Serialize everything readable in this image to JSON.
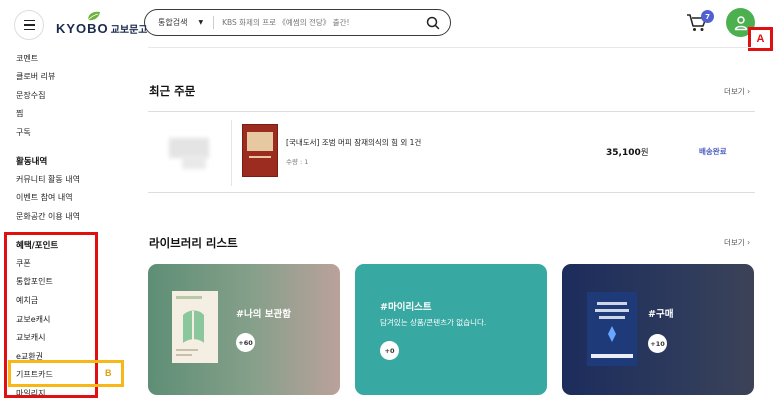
{
  "header": {
    "logo_en": "KYOBO",
    "logo_ko": "교보문고",
    "search_category": "통합검색",
    "search_placeholder": "KBS 화제의 프로 《예썸의 전당》 출간!",
    "cart_count": "7",
    "annotation_a": "A"
  },
  "sidebar": {
    "items_top": [
      "코멘트",
      "클로버 리뷰",
      "문장수집",
      "찜",
      "구독"
    ],
    "activity_title": "활동내역",
    "activity_items": [
      "커뮤니티 활동 내역",
      "이벤트 참여 내역",
      "문화공간 이용 내역"
    ],
    "benefit_title": "혜택/포인트",
    "benefit_items": [
      "쿠폰",
      "통합포인트",
      "예치금",
      "교보e캐시",
      "교보캐시",
      "e교환권",
      "기프트카드",
      "마일리지"
    ],
    "annotation_b": "B"
  },
  "recent_orders": {
    "title": "최근 주문",
    "more": "더보기 ›",
    "order": {
      "title": "[국내도서] 조범 머피 잠재의식의 힘 외 1건",
      "qty": "수량 : 1",
      "price": "35,100",
      "price_unit": "원",
      "status": "배송완료"
    }
  },
  "library": {
    "title": "라이브러리 리스트",
    "more": "더보기 ›",
    "cards": [
      {
        "label": "#나의 보관함",
        "badge": "+60",
        "subtitle": ""
      },
      {
        "label": "#마이리스트",
        "badge": "+0",
        "subtitle": "담겨있는 상품/콘텐츠가 없습니다."
      },
      {
        "label": "#구매",
        "badge": "+10",
        "subtitle": ""
      }
    ]
  },
  "colors": {
    "highlight_red": "#e01010",
    "highlight_yellow": "#f7b718",
    "user_green": "#4caf50",
    "status_blue": "#4a5bc0"
  }
}
